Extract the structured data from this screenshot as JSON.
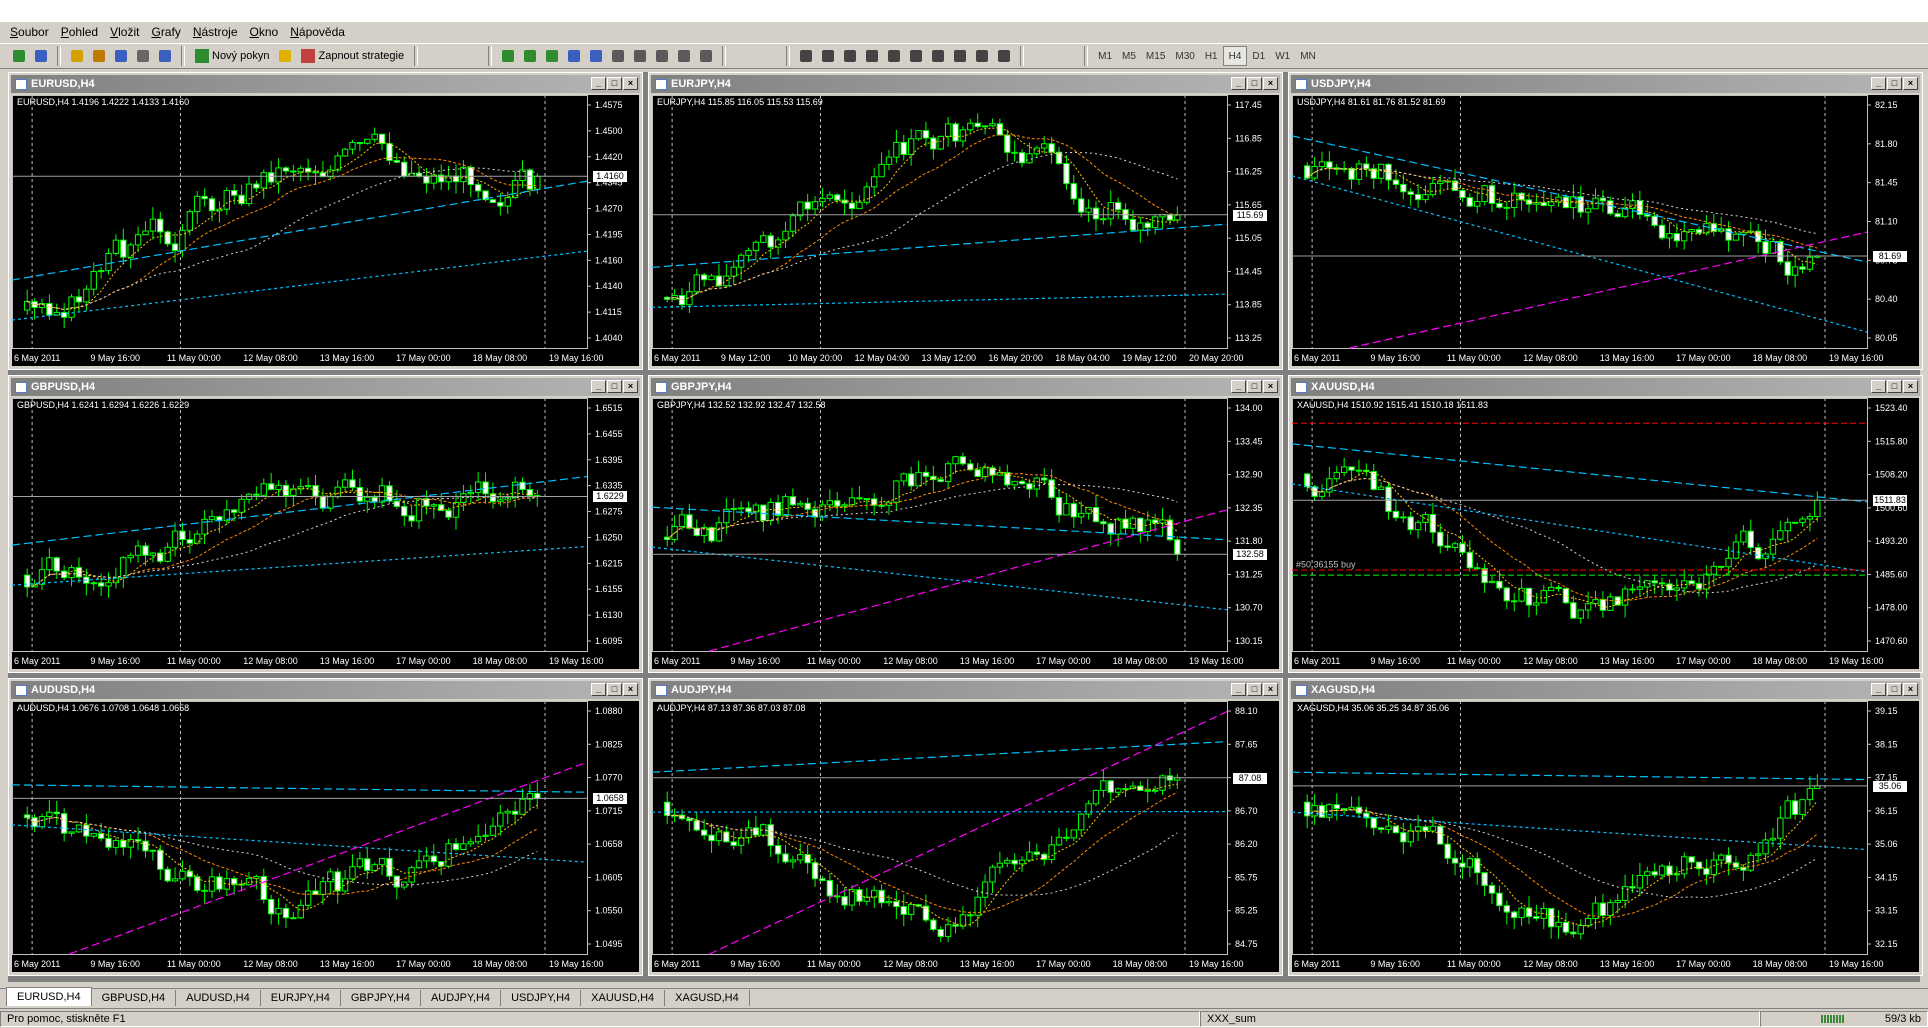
{
  "menu": [
    {
      "u": "S",
      "rest": "oubor"
    },
    {
      "u": "P",
      "rest": "ohled"
    },
    {
      "u": "V",
      "rest": "ložit"
    },
    {
      "u": "G",
      "rest": "rafy"
    },
    {
      "u": "N",
      "rest": "ástroje"
    },
    {
      "u": "O",
      "rest": "kno"
    },
    {
      "u": "N",
      "rest": "ápověda"
    }
  ],
  "toolbar": {
    "new_order": "Nový pokyn",
    "strategies": "Zapnout strategie",
    "timeframes": [
      "M1",
      "M5",
      "M15",
      "M30",
      "H1",
      "H4",
      "D1",
      "W1",
      "MN"
    ],
    "active_timeframe": "H4",
    "icons": [
      "new-chart-icon",
      "profiles-icon",
      "market-watch-icon",
      "navigator-icon",
      "terminal-icon",
      "strategy-tester-icon",
      "data-window-icon",
      "new-order-icon",
      "alert-icon",
      "expert-advisor-icon",
      "bar-chart-icon",
      "candlestick-icon",
      "line-chart-icon",
      "zoom-in-icon",
      "zoom-out-icon",
      "auto-scroll-icon",
      "chart-shift-icon",
      "indicators-icon",
      "periods-icon",
      "templates-icon",
      "cursor-icon",
      "crosshair-icon",
      "vertical-line-icon",
      "horizontal-line-icon",
      "trendline-icon",
      "channel-icon",
      "fibonacci-icon",
      "text-icon",
      "text-label-icon",
      "arrows-icon"
    ]
  },
  "charts": [
    {
      "title": "EURUSD,H4",
      "info": "EURUSD,H4  1.4196 1.4222 1.4133 1.4160",
      "price": "1.4160",
      "ticks": [
        "1.4575",
        "1.4500",
        "1.4420",
        "1.4345",
        "1.4270",
        "1.4195",
        "1.4160",
        "1.4140",
        "1.4115",
        "1.4040"
      ],
      "dates": [
        "6 May 2011",
        "9 May 16:00",
        "11 May 00:00",
        "12 May 08:00",
        "13 May 16:00",
        "17 May 00:00",
        "18 May 08:00",
        "19 May 16:00"
      ],
      "up": "#00ff00",
      "dn": "#ffffff",
      "seed": 3,
      "trend": [
        0.15,
        0.75,
        0.62
      ]
    },
    {
      "title": "EURJPY,H4",
      "info": "EURJPY,H4  115.85 116.05 115.53 115.69",
      "price": "115.69",
      "ticks": [
        "117.45",
        "116.85",
        "116.25",
        "115.65",
        "115.05",
        "114.45",
        "113.85",
        "113.25"
      ],
      "dates": [
        "6 May 2011",
        "9 May 12:00",
        "10 May 20:00",
        "12 May 04:00",
        "13 May 12:00",
        "16 May 20:00",
        "18 May 04:00",
        "19 May 12:00",
        "20 May 20:00"
      ],
      "up": "#00ff00",
      "dn": "#ffffff",
      "seed": 7,
      "trend": [
        0.2,
        0.85,
        0.45
      ]
    },
    {
      "title": "USDJPY,H4",
      "info": "USDJPY,H4  81.61 81.76 81.52 81.69",
      "price": "81.69",
      "ticks": [
        "82.15",
        "81.80",
        "81.45",
        "81.10",
        "80.75",
        "80.40",
        "80.05"
      ],
      "dates": [
        "6 May 2011",
        "9 May 16:00",
        "11 May 00:00",
        "12 May 08:00",
        "13 May 16:00",
        "17 May 00:00",
        "18 May 08:00",
        "19 May 16:00"
      ],
      "up": "#00ff00",
      "dn": "#ffffff",
      "seed": 11,
      "trend": [
        0.72,
        0.55,
        0.3
      ]
    },
    {
      "title": "GBPUSD,H4",
      "info": "GBPUSD,H4  1.6241 1.6294 1.6226 1.6229",
      "price": "1.6229",
      "ticks": [
        "1.6515",
        "1.6455",
        "1.6395",
        "1.6335",
        "1.6275",
        "1.6250",
        "1.6215",
        "1.6155",
        "1.6130",
        "1.6095"
      ],
      "dates": [
        "6 May 2011",
        "9 May 16:00",
        "11 May 00:00",
        "12 May 08:00",
        "13 May 16:00",
        "17 May 00:00",
        "18 May 08:00",
        "19 May 16:00"
      ],
      "up": "#00ff00",
      "dn": "#ffffff",
      "seed": 5,
      "trend": [
        0.3,
        0.6,
        0.65
      ]
    },
    {
      "title": "GBPJPY,H4",
      "info": "GBPJPY,H4  132.52 132.92 132.47 132.58",
      "price": "132.58",
      "ticks": [
        "134.00",
        "133.45",
        "132.90",
        "132.35",
        "131.80",
        "131.25",
        "130.70",
        "130.15"
      ],
      "dates": [
        "6 May 2011",
        "9 May 16:00",
        "11 May 00:00",
        "12 May 08:00",
        "13 May 16:00",
        "17 May 00:00",
        "18 May 08:00",
        "19 May 16:00"
      ],
      "up": "#00ff00",
      "dn": "#ffffff",
      "seed": 13,
      "trend": [
        0.45,
        0.75,
        0.4
      ]
    },
    {
      "title": "XAUUSD,H4",
      "info": "XAUUSD,H4  1510.92 1515.41 1510.18 1511.83",
      "price": "1511.83",
      "ticks": [
        "1523.40",
        "1515.80",
        "1508.20",
        "1500.60",
        "1493.20",
        "1485.60",
        "1478.00",
        "1470.60"
      ],
      "dates": [
        "6 May 2011",
        "9 May 16:00",
        "11 May 00:00",
        "12 May 08:00",
        "13 May 16:00",
        "17 May 00:00",
        "18 May 08:00",
        "19 May 16:00"
      ],
      "up": "#00ff00",
      "dn": "#ffffff",
      "seed": 17,
      "trend": [
        0.7,
        0.15,
        0.55
      ]
    },
    {
      "title": "AUDUSD,H4",
      "info": "AUDUSD,H4  1.0676 1.0708 1.0648 1.0658",
      "price": "1.0658",
      "ticks": [
        "1.0880",
        "1.0825",
        "1.0770",
        "1.0715",
        "1.0658",
        "1.0605",
        "1.0550",
        "1.0495"
      ],
      "dates": [
        "6 May 2011",
        "9 May 16:00",
        "11 May 00:00",
        "12 May 08:00",
        "13 May 16:00",
        "17 May 00:00",
        "18 May 08:00",
        "19 May 16:00"
      ],
      "up": "#00ff00",
      "dn": "#ffffff",
      "seed": 19,
      "trend": [
        0.55,
        0.15,
        0.6
      ]
    },
    {
      "title": "AUDJPY,H4",
      "info": "AUDJPY,H4  87.13 87.36 87.03 87.08",
      "price": "87.08",
      "ticks": [
        "88.10",
        "87.65",
        "87.08",
        "86.70",
        "86.20",
        "85.75",
        "85.25",
        "84.75"
      ],
      "dates": [
        "6 May 2011",
        "9 May 16:00",
        "11 May 00:00",
        "12 May 08:00",
        "13 May 16:00",
        "17 May 00:00",
        "18 May 08:00",
        "19 May 16:00"
      ],
      "up": "#00ff00",
      "dn": "#ffffff",
      "seed": 23,
      "trend": [
        0.6,
        0.1,
        0.8
      ]
    },
    {
      "title": "XAGUSD,H4",
      "info": "XAGUSD,H4  35.06 35.25 34.87 35.06",
      "price": "35.06",
      "ticks": [
        "39.15",
        "38.15",
        "37.15",
        "36.15",
        "35.06",
        "34.15",
        "33.15",
        "32.15"
      ],
      "dates": [
        "6 May 2011",
        "9 May 16:00",
        "11 May 00:00",
        "12 May 08:00",
        "13 May 16:00",
        "17 May 00:00",
        "18 May 08:00",
        "19 May 16:00"
      ],
      "up": "#00ff00",
      "dn": "#ffffff",
      "seed": 29,
      "trend": [
        0.6,
        0.1,
        0.65
      ]
    }
  ],
  "xau_label": "#50 36155 buy",
  "tabs": [
    "EURUSD,H4",
    "GBPUSD,H4",
    "AUDUSD,H4",
    "EURJPY,H4",
    "GBPJPY,H4",
    "AUDJPY,H4",
    "USDJPY,H4",
    "XAUUSD,H4",
    "XAGUSD,H4"
  ],
  "active_tab": "EURUSD,H4",
  "status": {
    "help": "Pro pomoc, stiskněte F1",
    "profile": "XXX_sum",
    "traffic": "59/3 kb"
  }
}
